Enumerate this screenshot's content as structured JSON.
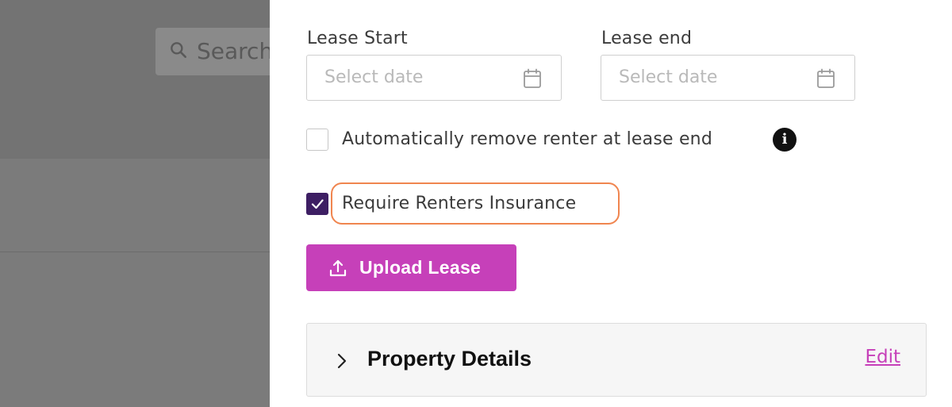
{
  "background": {
    "search_text": "Search"
  },
  "lease": {
    "start_label": "Lease Start",
    "end_label": "Lease end",
    "start_placeholder": "Select date",
    "end_placeholder": "Select date"
  },
  "options": {
    "auto_remove_label": "Automatically remove renter at lease end",
    "auto_remove_checked": false,
    "require_insurance_label": "Require Renters Insurance",
    "require_insurance_checked": true,
    "info_icon": "i"
  },
  "upload": {
    "label": "Upload Lease"
  },
  "property": {
    "title": "Property Details",
    "edit_label": "Edit"
  },
  "colors": {
    "accent": "#c640b9",
    "checkbox_checked": "#3d1e63",
    "highlight": "#f0854f"
  }
}
